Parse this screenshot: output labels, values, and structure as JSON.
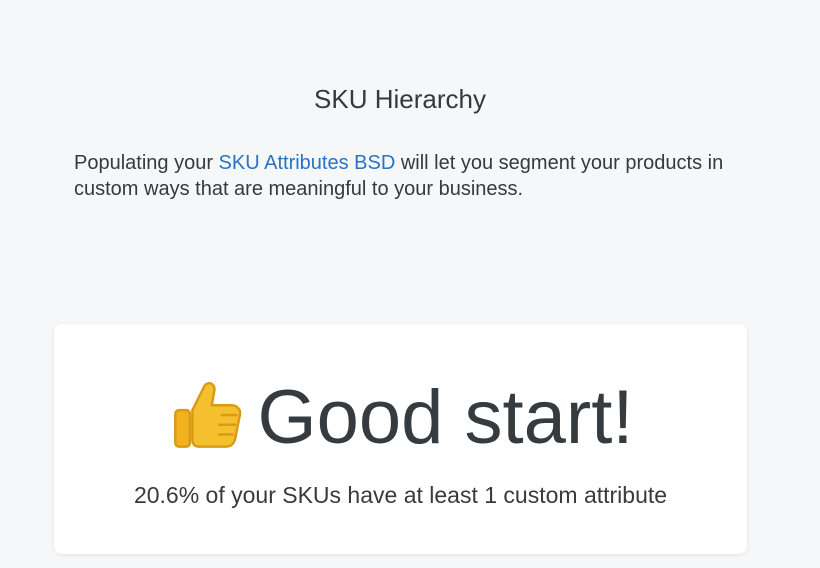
{
  "section": {
    "title": "SKU Hierarchy"
  },
  "intro": {
    "prefix": "Populating your ",
    "link_label": "SKU Attributes BSD",
    "suffix": " will let you segment your products in custom ways that are meaningful to your business.",
    "link_color": "#2774c7"
  },
  "card": {
    "icon": "thumbs-up-icon",
    "headline": "Good start!",
    "stat_text": "20.6% of your SKUs have at least 1 custom attribute"
  }
}
